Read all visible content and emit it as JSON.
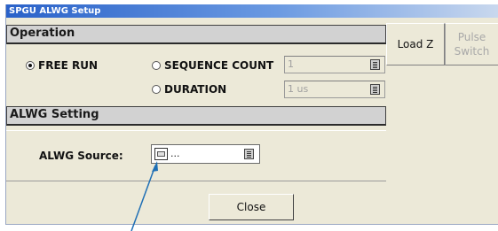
{
  "window": {
    "title": "SPGU ALWG Setup"
  },
  "operation": {
    "header": "Operation",
    "radios": {
      "free_run": "FREE RUN",
      "sequence_count": "SEQUENCE COUNT",
      "duration": "DURATION"
    },
    "sequence_count_value": "1",
    "duration_value": "1 us"
  },
  "alwg": {
    "header": "ALWG Setting",
    "source_label": "ALWG Source:",
    "source_value": "..."
  },
  "side_buttons": {
    "load_z": "Load Z",
    "pulse_switch": "Pulse Switch"
  },
  "footer": {
    "close": "Close"
  },
  "colors": {
    "title_gradient_start": "#2a62c9",
    "dialog_bg": "#ece9d8",
    "section_header_bg": "#d2d2d2",
    "arrow": "#1f6fb5"
  }
}
